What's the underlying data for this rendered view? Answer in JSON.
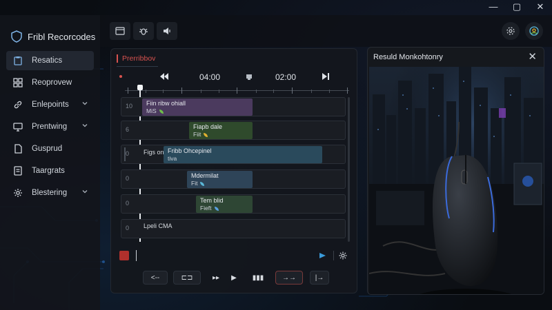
{
  "window": {
    "controls": [
      "—",
      "▢",
      "✕"
    ]
  },
  "sidebar": {
    "app_title": "Fribl Recorcodes",
    "items": [
      {
        "label": "Resatics",
        "icon": "clipboard-icon",
        "active": true,
        "chevron": false
      },
      {
        "label": "Reoprovew",
        "icon": "grid-icon",
        "active": false,
        "chevron": false
      },
      {
        "label": "Enlepoints",
        "icon": "link-icon",
        "active": false,
        "chevron": true
      },
      {
        "label": "Prentwing",
        "icon": "monitor-icon",
        "active": false,
        "chevron": true
      },
      {
        "label": "Gusprud",
        "icon": "document-icon",
        "active": false,
        "chevron": false
      },
      {
        "label": "Taargrats",
        "icon": "list-icon",
        "active": false,
        "chevron": false
      },
      {
        "label": "Blestering",
        "icon": "gear-icon",
        "active": false,
        "chevron": true
      }
    ]
  },
  "toolbar": {
    "buttons": [
      "panel-icon",
      "bug-icon",
      "speaker-icon"
    ],
    "right_buttons": [
      "settings-icon",
      "profile-icon"
    ]
  },
  "timeline": {
    "tab_label": "Prerribbov",
    "time_start": "04:00",
    "time_end": "02:00",
    "tracks": [
      {
        "num": "10",
        "clip_title": "Fiin ribw ohiall",
        "clip_sub": "MiS",
        "color": "#4b3a5e",
        "icon_color": "#6fbf4a"
      },
      {
        "num": "6",
        "clip_title": "Fiapb dale",
        "clip_sub": "Fiit",
        "color": "#2f4a2c",
        "icon_color": "#e0b030"
      },
      {
        "num": "0",
        "label": "Figs on",
        "clip_title": "Fribb Ohcepinel",
        "clip_sub": "tiva",
        "color": "#2a4a5c",
        "icon_color": "#b8c0c8"
      },
      {
        "num": "0",
        "clip_title": "Mdermilat",
        "clip_sub": "Fit",
        "color": "#2e4458",
        "icon_color": "#5ab8d8"
      },
      {
        "num": "0",
        "clip_title": "Tem blid",
        "clip_sub": "Fieft",
        "color": "#2e4634",
        "icon_color": "#5aa0e0"
      },
      {
        "num": "0",
        "label": "Lpeli CMA",
        "clip_title": "",
        "clip_sub": "",
        "color": "",
        "icon_color": ""
      }
    ],
    "bottom_buttons": [
      "<--",
      "⊏⊐",
      "▸▸",
      "▶",
      "▮▮▮",
      "→→",
      "|→"
    ]
  },
  "preview": {
    "title": "Resuld Monkohtonry",
    "close": "✕"
  }
}
